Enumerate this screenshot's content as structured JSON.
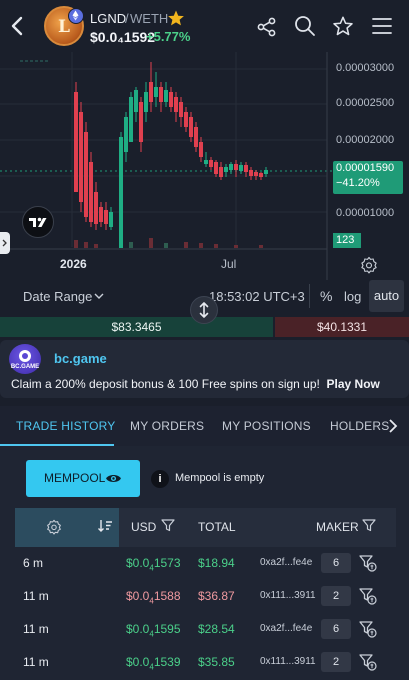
{
  "header": {
    "base_symbol": "LGND",
    "separator": "/",
    "quote_symbol": "WETH",
    "price": "$0.0₄1592",
    "change": "+5.77%",
    "token_logo_letter": "L"
  },
  "chart": {
    "y_ticks": [
      "0.00003000",
      "0.00002500",
      "0.00002000",
      "0.00001000"
    ],
    "current_price": "0.00001590",
    "current_change": "−41.20%",
    "volume_label": "123",
    "x_ticks": [
      "2026",
      "Jul"
    ]
  },
  "toolbar": {
    "date_range": "Date Range",
    "clock": "18:53:02 UTC+3",
    "percent": "%",
    "log": "log",
    "auto": "auto"
  },
  "flow": {
    "buy_volume": "$83.3465",
    "sell_volume": "$40.1331"
  },
  "ad": {
    "logo_text": "BC.GAME",
    "title": "bc.game",
    "text": "Claim a 200% deposit bonus & 100 Free spins on sign up!",
    "cta": "Play Now"
  },
  "tabs": [
    "TRADE HISTORY",
    "MY ORDERS",
    "MY POSITIONS",
    "HOLDERS"
  ],
  "mempool": {
    "button": "MEMPOOL",
    "info": "i",
    "status": "Mempool is empty"
  },
  "table": {
    "headers": {
      "usd": "USD",
      "total": "TOTAL",
      "maker": "MAKER"
    },
    "rows": [
      {
        "age": "6 m",
        "usd_prefix": "$0.0",
        "usd_sub": "4",
        "usd_rest": "1573",
        "total": "$18.94",
        "maker": "0xa2f...fe4e",
        "txns": "6",
        "side": "buy"
      },
      {
        "age": "11 m",
        "usd_prefix": "$0.0",
        "usd_sub": "4",
        "usd_rest": "1588",
        "total": "$36.87",
        "maker": "0x111...3911",
        "txns": "2",
        "side": "sell"
      },
      {
        "age": "11 m",
        "usd_prefix": "$0.0",
        "usd_sub": "4",
        "usd_rest": "1595",
        "total": "$28.54",
        "maker": "0xa2f...fe4e",
        "txns": "6",
        "side": "buy"
      },
      {
        "age": "11 m",
        "usd_prefix": "$0.0",
        "usd_sub": "4",
        "usd_rest": "1539",
        "total": "$35.85",
        "maker": "0x111...3911",
        "txns": "2",
        "side": "buy"
      }
    ]
  },
  "colors": {
    "background": "#1a1f2b",
    "up": "#4bd08a",
    "down": "#f09aa0",
    "accent": "#34c8f0",
    "candle_up": "#1fae84",
    "candle_down": "#e0404f"
  }
}
